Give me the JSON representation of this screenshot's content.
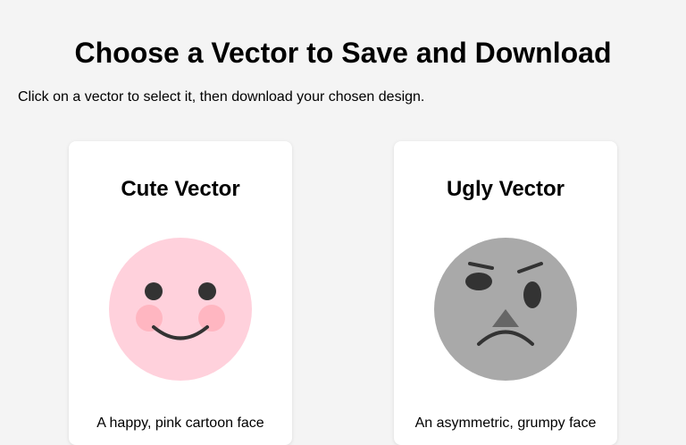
{
  "page": {
    "title": "Choose a Vector to Save and Download",
    "instructions": "Click on a vector to select it, then download your chosen design."
  },
  "vectors": [
    {
      "title": "Cute Vector",
      "description": "A happy, pink cartoon face",
      "colors": {
        "face": "#ffd1dc",
        "cheeks": "#ffb6c1",
        "features": "#333333"
      }
    },
    {
      "title": "Ugly Vector",
      "description": "An asymmetric, grumpy face",
      "colors": {
        "face": "#a9a9a9",
        "nose": "#666666",
        "features": "#333333"
      }
    }
  ]
}
